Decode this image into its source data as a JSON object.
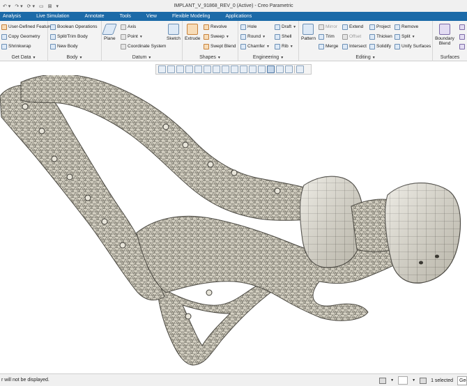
{
  "window": {
    "title": "IMPLANT_V_91868_REV_0 (Active) - Creo Parametric"
  },
  "menu_tabs": [
    "Analysis",
    "Live Simulation",
    "Annotate",
    "Tools",
    "View",
    "Flexible Modeling",
    "Applications"
  ],
  "ribbon": {
    "get_data": {
      "label": "Get Data",
      "items": [
        "User-Defined Feature",
        "Copy Geometry",
        "Shrinkwrap"
      ]
    },
    "body": {
      "label": "Body",
      "items": [
        "Boolean Operations",
        "Split/Trim Body",
        "New Body"
      ]
    },
    "datum": {
      "label": "Datum",
      "plane": "Plane",
      "axis": "Axis",
      "point": "Point",
      "csys": "Coordinate System",
      "sketch": "Sketch"
    },
    "shapes": {
      "label": "Shapes",
      "extrude": "Extrude",
      "revolve": "Revolve",
      "sweep": "Sweep",
      "swept_blend": "Swept Blend"
    },
    "engineering": {
      "label": "Engineering",
      "hole": "Hole",
      "round": "Round",
      "chamfer": "Chamfer",
      "draft": "Draft",
      "shell": "Shell",
      "rib": "Rib"
    },
    "editing": {
      "label": "Editing",
      "pattern": "Pattern",
      "mirror": "Mirror",
      "trim": "Trim",
      "merge": "Merge",
      "extend": "Extend",
      "offset": "Offset",
      "intersect": "Intersect",
      "project": "Project",
      "thicken": "Thicken",
      "solidify": "Solidify",
      "remove": "Remove",
      "split": "Split",
      "unify_surfaces": "Unify Surfaces"
    },
    "surfaces": {
      "label": "Surfaces",
      "boundary_blend": "Boundary Blend"
    }
  },
  "status": {
    "message": "r will not be displayed.",
    "selected": "1 selected",
    "filter": "Geometry"
  },
  "colors": {
    "tab_bar": "#1c6aa8",
    "model_surface": "#d4d0c2",
    "mesh_lines": "#5f5d54"
  }
}
